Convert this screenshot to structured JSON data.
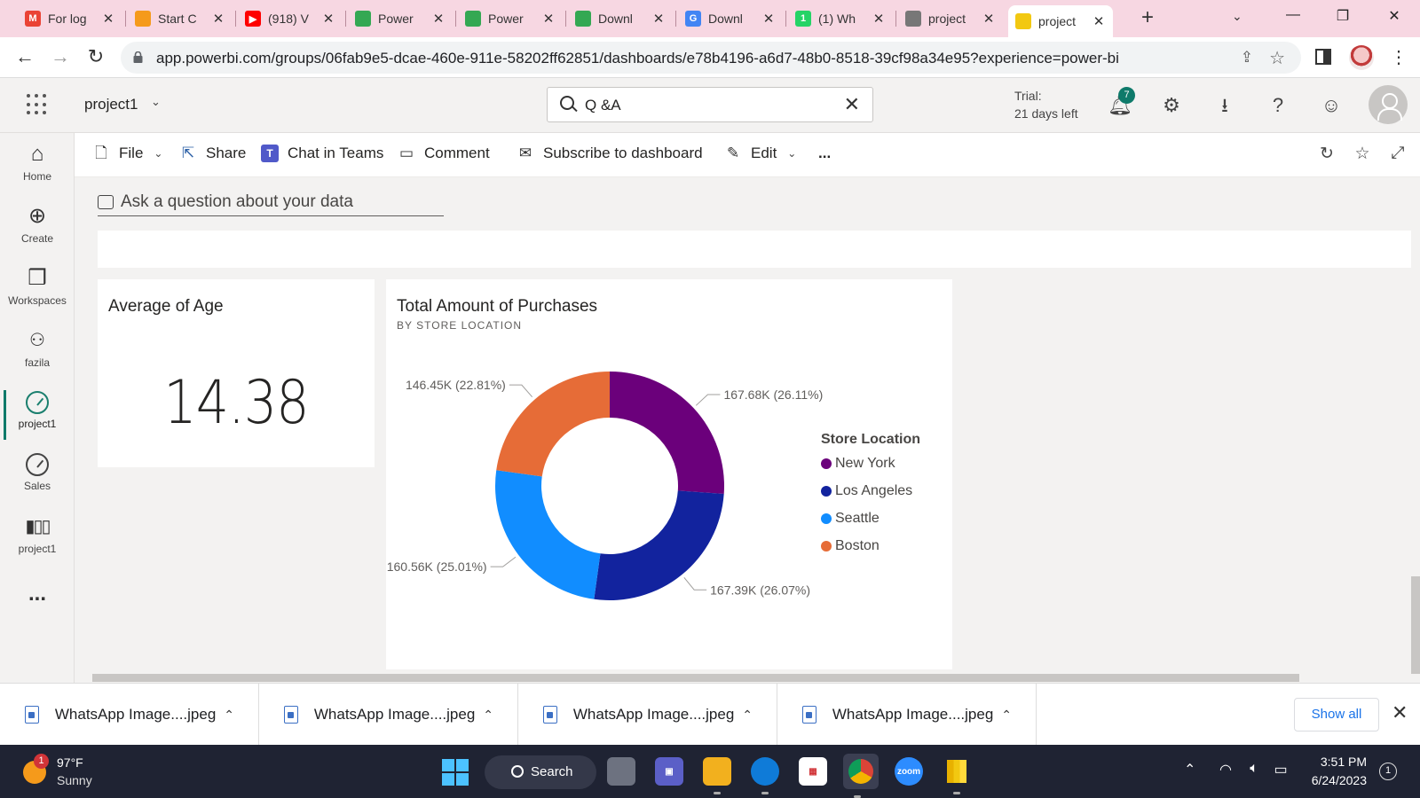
{
  "browser": {
    "tabs": [
      {
        "title": "For log",
        "fav": "M",
        "fav_color": "#ea4335"
      },
      {
        "title": "Start C",
        "fav": "",
        "fav_color": "#f59a1b"
      },
      {
        "title": "(918) V",
        "fav": "▶",
        "fav_color": "#ff0000"
      },
      {
        "title": "Power",
        "fav": "",
        "fav_color": "#34a853"
      },
      {
        "title": "Power",
        "fav": "",
        "fav_color": "#34a853"
      },
      {
        "title": "Downl",
        "fav": "",
        "fav_color": "#34a853"
      },
      {
        "title": "Downl",
        "fav": "G",
        "fav_color": "#4285f4"
      },
      {
        "title": "(1) Wh",
        "fav": "1",
        "fav_color": "#25d366"
      },
      {
        "title": "project",
        "fav": "",
        "fav_color": "#777777"
      },
      {
        "title": "project",
        "fav": "",
        "fav_color": "#f2c811"
      }
    ],
    "active_tab_index": 9,
    "url": "app.powerbi.com/groups/06fab9e5-dcae-460e-911e-58202ff62851/dashboards/e78b4196-a6d7-48b0-8518-39cf98a34e95?experience=power-bi"
  },
  "pbi": {
    "workspace_name": "project1",
    "search_value": "Q &A",
    "trial_line1": "Trial:",
    "trial_line2": "21 days left",
    "notification_count": "7",
    "nav": [
      {
        "label": "Home",
        "icon": "home-icon"
      },
      {
        "label": "Create",
        "icon": "create-icon"
      },
      {
        "label": "Workspaces",
        "icon": "workspaces-icon"
      },
      {
        "label": "fazila",
        "icon": "workspace-people-icon"
      },
      {
        "label": "project1",
        "icon": "dashboard-gauge-icon"
      },
      {
        "label": "Sales",
        "icon": "dashboard-gauge-icon"
      },
      {
        "label": "project1",
        "icon": "report-chart-icon"
      }
    ],
    "more_label": "...",
    "actions": {
      "file": "File",
      "share": "Share",
      "chat": "Chat in Teams",
      "comment": "Comment",
      "subscribe": "Subscribe to dashboard",
      "edit": "Edit",
      "more": "..."
    },
    "qa_prompt": "Ask a question about your data"
  },
  "tiles": {
    "age": {
      "title": "Average of Age",
      "value": "14.38"
    },
    "donut": {
      "title": "Total Amount of Purchases",
      "subtitle": "BY STORE LOCATION"
    }
  },
  "chart_data": {
    "type": "pie",
    "donut": true,
    "title": "Total Amount of Purchases",
    "subtitle": "BY STORE LOCATION",
    "legend_title": "Store Location",
    "legend_position": "right",
    "categories": [
      "New York",
      "Los Angeles",
      "Seattle",
      "Boston"
    ],
    "values": [
      167680,
      167390,
      160560,
      146450
    ],
    "percents": [
      26.11,
      26.07,
      25.01,
      22.81
    ],
    "data_labels": [
      "167.68K (26.11%)",
      "167.39K (26.07%)",
      "160.56K (25.01%)",
      "146.45K (22.81%)"
    ],
    "colors": [
      "#6b007b",
      "#12239e",
      "#118dff",
      "#e66c37"
    ]
  },
  "downloads": {
    "items": [
      "WhatsApp Image....jpeg",
      "WhatsApp Image....jpeg",
      "WhatsApp Image....jpeg",
      "WhatsApp Image....jpeg"
    ],
    "show_all": "Show all"
  },
  "taskbar": {
    "weather_badge": "1",
    "temp": "97°F",
    "condition": "Sunny",
    "search_label": "Search",
    "time": "3:51 PM",
    "date": "6/24/2023",
    "notifications": "1"
  }
}
